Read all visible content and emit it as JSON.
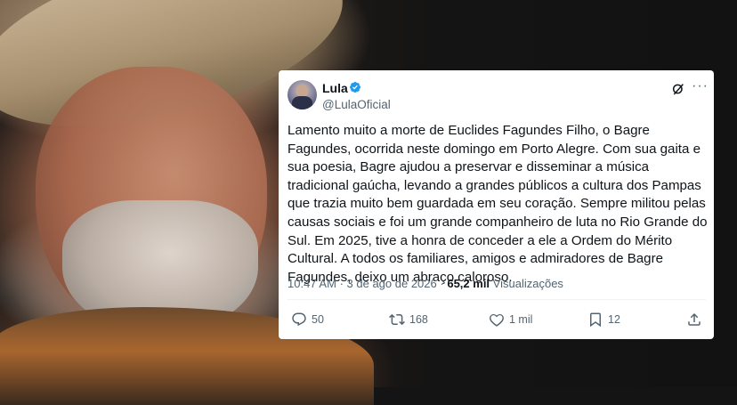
{
  "tweet": {
    "author_name": "Lula",
    "handle": "@LulaOficial",
    "text": "Lamento muito a morte de Euclides Fagundes Filho, o Bagre Fagundes, ocorrida neste domingo em Porto Alegre. Com sua gaita e sua poesia, Bagre ajudou a preservar e disseminar a música tradicional gaúcha, levando a grandes públicos a cultura dos Pampas que trazia muito bem guardada em seu coração. Sempre militou pelas causas sociais e foi um grande companheiro de luta no Rio Grande do Sul. Em 2025, tive a honra de conceder a ele a Ordem do Mérito Cultural. A todos os familiares, amigos e admiradores de Bagre Fagundes, deixo um abraço caloroso.",
    "time": "10:47 AM",
    "separator": "·",
    "date": "3 de ago de 2026",
    "views_count": "65,2 mil",
    "views_label": "Visualizações",
    "more_glyph": "···",
    "actions": {
      "replies": "50",
      "reposts": "168",
      "likes": "1 mil",
      "bookmarks": "12"
    },
    "icons": {
      "verified": "verified-badge-icon",
      "grok": "grok-icon",
      "more": "more-icon",
      "reply": "reply-icon",
      "repost": "repost-icon",
      "like": "like-icon",
      "bookmark": "bookmark-icon",
      "share": "share-icon"
    },
    "colors": {
      "verified": "#1d9bf0",
      "text": "#0f1419",
      "secondary": "#536471"
    }
  }
}
